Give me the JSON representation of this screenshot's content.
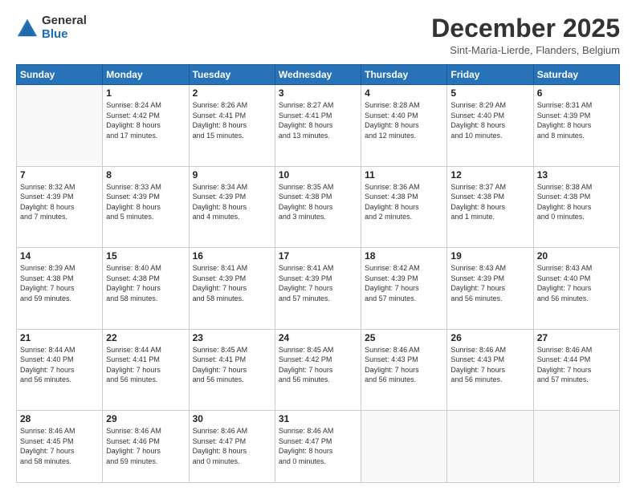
{
  "logo": {
    "general": "General",
    "blue": "Blue"
  },
  "header": {
    "month": "December 2025",
    "location": "Sint-Maria-Lierde, Flanders, Belgium"
  },
  "days": [
    "Sunday",
    "Monday",
    "Tuesday",
    "Wednesday",
    "Thursday",
    "Friday",
    "Saturday"
  ],
  "weeks": [
    [
      {
        "day": "",
        "info": ""
      },
      {
        "day": "1",
        "info": "Sunrise: 8:24 AM\nSunset: 4:42 PM\nDaylight: 8 hours\nand 17 minutes."
      },
      {
        "day": "2",
        "info": "Sunrise: 8:26 AM\nSunset: 4:41 PM\nDaylight: 8 hours\nand 15 minutes."
      },
      {
        "day": "3",
        "info": "Sunrise: 8:27 AM\nSunset: 4:41 PM\nDaylight: 8 hours\nand 13 minutes."
      },
      {
        "day": "4",
        "info": "Sunrise: 8:28 AM\nSunset: 4:40 PM\nDaylight: 8 hours\nand 12 minutes."
      },
      {
        "day": "5",
        "info": "Sunrise: 8:29 AM\nSunset: 4:40 PM\nDaylight: 8 hours\nand 10 minutes."
      },
      {
        "day": "6",
        "info": "Sunrise: 8:31 AM\nSunset: 4:39 PM\nDaylight: 8 hours\nand 8 minutes."
      }
    ],
    [
      {
        "day": "7",
        "info": "Sunrise: 8:32 AM\nSunset: 4:39 PM\nDaylight: 8 hours\nand 7 minutes."
      },
      {
        "day": "8",
        "info": "Sunrise: 8:33 AM\nSunset: 4:39 PM\nDaylight: 8 hours\nand 5 minutes."
      },
      {
        "day": "9",
        "info": "Sunrise: 8:34 AM\nSunset: 4:39 PM\nDaylight: 8 hours\nand 4 minutes."
      },
      {
        "day": "10",
        "info": "Sunrise: 8:35 AM\nSunset: 4:38 PM\nDaylight: 8 hours\nand 3 minutes."
      },
      {
        "day": "11",
        "info": "Sunrise: 8:36 AM\nSunset: 4:38 PM\nDaylight: 8 hours\nand 2 minutes."
      },
      {
        "day": "12",
        "info": "Sunrise: 8:37 AM\nSunset: 4:38 PM\nDaylight: 8 hours\nand 1 minute."
      },
      {
        "day": "13",
        "info": "Sunrise: 8:38 AM\nSunset: 4:38 PM\nDaylight: 8 hours\nand 0 minutes."
      }
    ],
    [
      {
        "day": "14",
        "info": "Sunrise: 8:39 AM\nSunset: 4:38 PM\nDaylight: 7 hours\nand 59 minutes."
      },
      {
        "day": "15",
        "info": "Sunrise: 8:40 AM\nSunset: 4:38 PM\nDaylight: 7 hours\nand 58 minutes."
      },
      {
        "day": "16",
        "info": "Sunrise: 8:41 AM\nSunset: 4:39 PM\nDaylight: 7 hours\nand 58 minutes."
      },
      {
        "day": "17",
        "info": "Sunrise: 8:41 AM\nSunset: 4:39 PM\nDaylight: 7 hours\nand 57 minutes."
      },
      {
        "day": "18",
        "info": "Sunrise: 8:42 AM\nSunset: 4:39 PM\nDaylight: 7 hours\nand 57 minutes."
      },
      {
        "day": "19",
        "info": "Sunrise: 8:43 AM\nSunset: 4:39 PM\nDaylight: 7 hours\nand 56 minutes."
      },
      {
        "day": "20",
        "info": "Sunrise: 8:43 AM\nSunset: 4:40 PM\nDaylight: 7 hours\nand 56 minutes."
      }
    ],
    [
      {
        "day": "21",
        "info": "Sunrise: 8:44 AM\nSunset: 4:40 PM\nDaylight: 7 hours\nand 56 minutes."
      },
      {
        "day": "22",
        "info": "Sunrise: 8:44 AM\nSunset: 4:41 PM\nDaylight: 7 hours\nand 56 minutes."
      },
      {
        "day": "23",
        "info": "Sunrise: 8:45 AM\nSunset: 4:41 PM\nDaylight: 7 hours\nand 56 minutes."
      },
      {
        "day": "24",
        "info": "Sunrise: 8:45 AM\nSunset: 4:42 PM\nDaylight: 7 hours\nand 56 minutes."
      },
      {
        "day": "25",
        "info": "Sunrise: 8:46 AM\nSunset: 4:43 PM\nDaylight: 7 hours\nand 56 minutes."
      },
      {
        "day": "26",
        "info": "Sunrise: 8:46 AM\nSunset: 4:43 PM\nDaylight: 7 hours\nand 56 minutes."
      },
      {
        "day": "27",
        "info": "Sunrise: 8:46 AM\nSunset: 4:44 PM\nDaylight: 7 hours\nand 57 minutes."
      }
    ],
    [
      {
        "day": "28",
        "info": "Sunrise: 8:46 AM\nSunset: 4:45 PM\nDaylight: 7 hours\nand 58 minutes."
      },
      {
        "day": "29",
        "info": "Sunrise: 8:46 AM\nSunset: 4:46 PM\nDaylight: 7 hours\nand 59 minutes."
      },
      {
        "day": "30",
        "info": "Sunrise: 8:46 AM\nSunset: 4:47 PM\nDaylight: 8 hours\nand 0 minutes."
      },
      {
        "day": "31",
        "info": "Sunrise: 8:46 AM\nSunset: 4:47 PM\nDaylight: 8 hours\nand 0 minutes."
      },
      {
        "day": "",
        "info": ""
      },
      {
        "day": "",
        "info": ""
      },
      {
        "day": "",
        "info": ""
      }
    ]
  ]
}
